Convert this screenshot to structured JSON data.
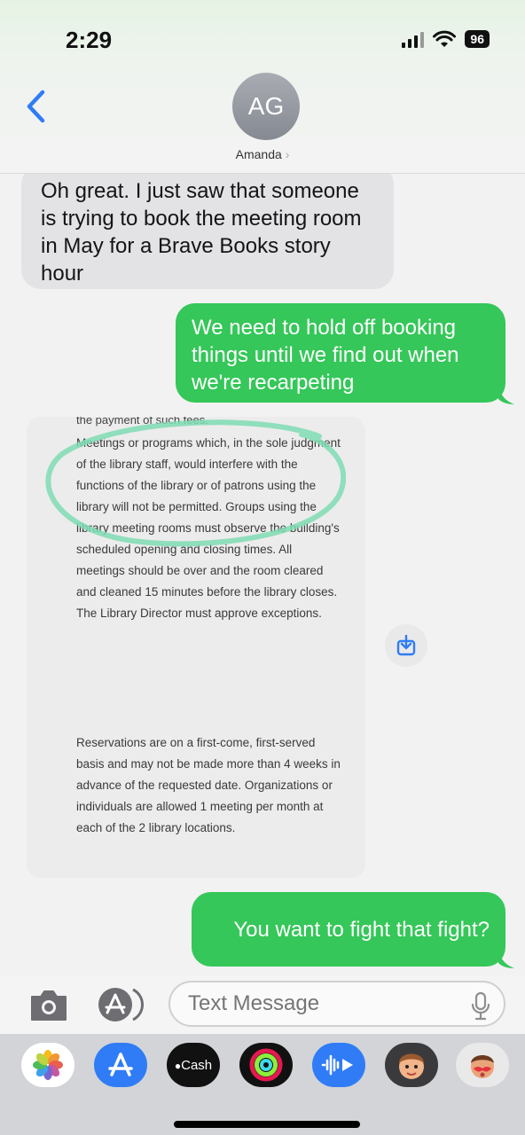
{
  "status_bar": {
    "time": "2:29",
    "battery": "96"
  },
  "header": {
    "avatar_initials": "AG",
    "contact_name": "Amanda",
    "contact_chevron": "›",
    "back_icon": "chevron-left-icon"
  },
  "messages": {
    "incoming_1": "Oh great. I just saw that someone is trying to book the meeting room in May for a Brave Books story hour",
    "outgoing_1": "We need to hold off booking things until we find out when we're recarpeting",
    "outgoing_2": "You want to fight that fight?"
  },
  "document": {
    "top_fragment": "the payment of such fees.",
    "paragraph_1": "Meetings or programs which, in the sole judgment of the library staff, would interfere with the functions of the library or of patrons using the library will not be permitted. Groups using the library meeting rooms must observe the building's scheduled opening and closing times. All meetings should be over and the room cleared and cleaned 15 minutes before the library closes. The Library Director must approve exceptions.",
    "paragraph_2": "Reservations are on a first-come, first-served basis and may not be made more than 4 weeks in advance of the requested date. Organizations or individuals are allowed 1 meeting per month at each of the 2 library locations.",
    "highlight_color": "#7fdcb4"
  },
  "input_bar": {
    "placeholder": "Text Message"
  },
  "app_drawer": {
    "cash_label": "Cash",
    "apps": [
      "photos-icon",
      "app-store-icon",
      "apple-cash-icon",
      "activity-icon",
      "audio-message-icon",
      "memoji-icon",
      "memoji-stickers-icon"
    ]
  },
  "colors": {
    "outgoing_bubble": "#35c759",
    "incoming_bubble": "#e3e3e6",
    "accent_blue": "#2f7cf6"
  }
}
